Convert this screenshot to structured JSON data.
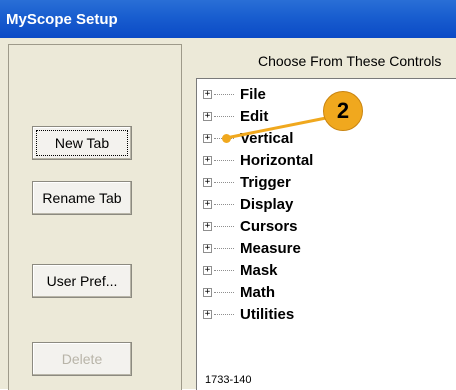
{
  "window": {
    "title": "MyScope Setup"
  },
  "heading": "Choose From These Controls",
  "buttons": {
    "new_tab": "New Tab",
    "rename_tab": "Rename Tab",
    "user_pref": "User Pref...",
    "delete": "Delete"
  },
  "tree": {
    "items": [
      {
        "label": "File"
      },
      {
        "label": "Edit"
      },
      {
        "label": "Vertical"
      },
      {
        "label": "Horizontal"
      },
      {
        "label": "Trigger"
      },
      {
        "label": "Display"
      },
      {
        "label": "Cursors"
      },
      {
        "label": "Measure"
      },
      {
        "label": "Mask"
      },
      {
        "label": "Math"
      },
      {
        "label": "Utilities"
      }
    ],
    "expander_symbol": "+"
  },
  "callout": {
    "number": "2",
    "color": "#f0a81e"
  },
  "figure_id": "1733-140",
  "colors": {
    "titlebar": "#0b4ac6",
    "window_bg": "#ece9d8"
  }
}
